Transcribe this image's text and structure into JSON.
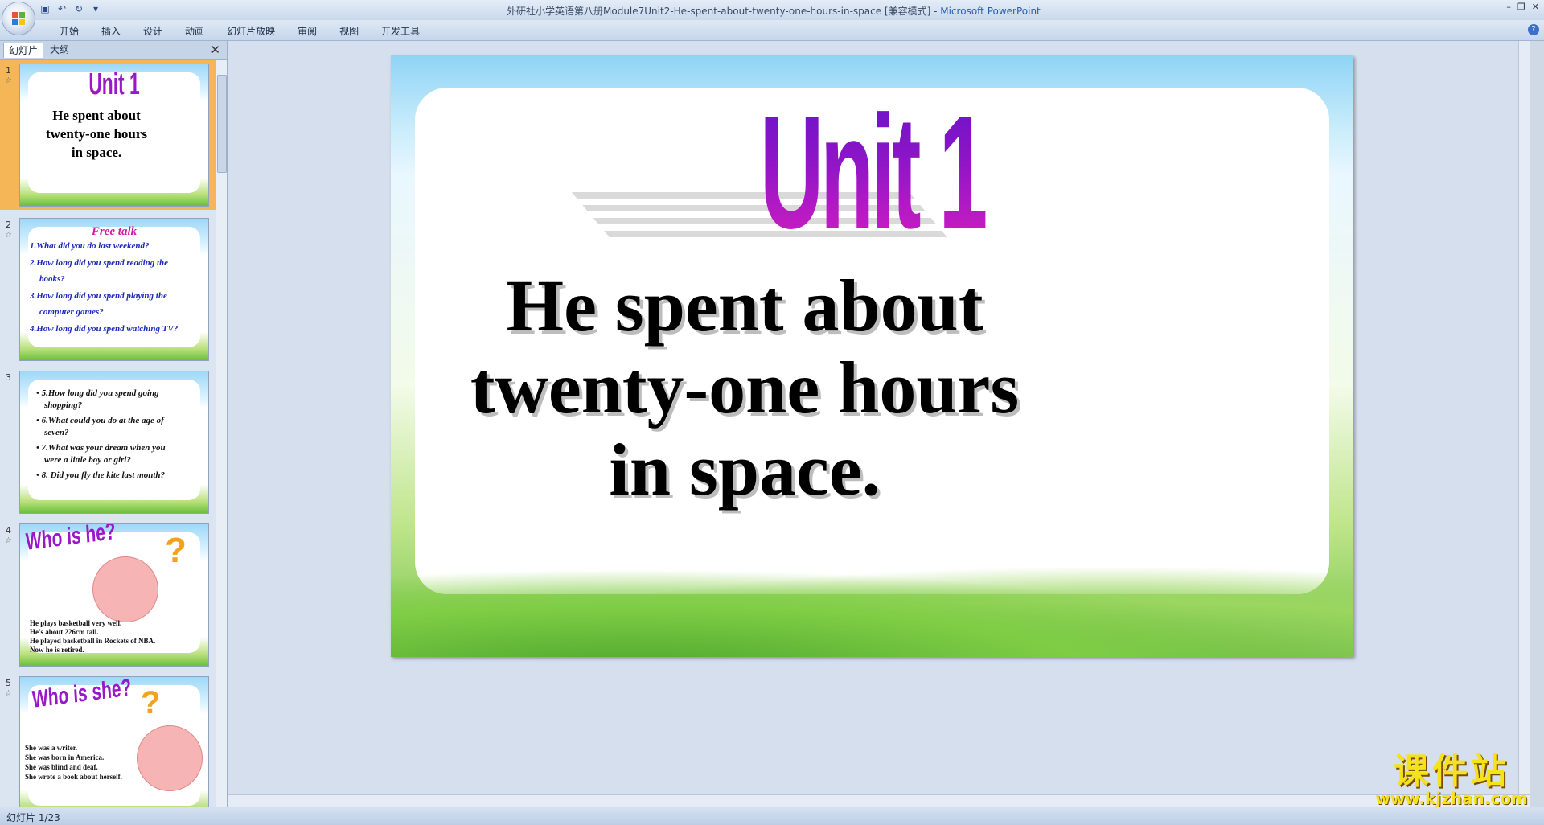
{
  "window": {
    "title_doc": "外研社小学英语第八册Module7Unit2-He-spent-about-twenty-one-hours-in-space [兼容模式] -",
    "title_app": "Microsoft PowerPoint"
  },
  "ribbon": {
    "tabs": [
      "开始",
      "插入",
      "设计",
      "动画",
      "幻灯片放映",
      "审阅",
      "视图",
      "开发工具"
    ]
  },
  "left_pane": {
    "tabs": [
      "幻灯片",
      "大纲"
    ],
    "slides": [
      {
        "num": "1",
        "title": "Unit 1",
        "lines": [
          "He spent about",
          "twenty-one hours",
          "in space."
        ]
      },
      {
        "num": "2",
        "title": "Free talk",
        "lines": [
          "1.What did you do last weekend?",
          "2.How long did you spend reading the",
          "books?",
          "3.How long did you spend playing the",
          "computer games?",
          "4.How long did you spend watching TV?"
        ]
      },
      {
        "num": "3",
        "lines": [
          "• 5.How long did you spend going",
          "shopping?",
          "• 6.What could you do at the age of",
          "seven?",
          "• 7.What was your dream when you",
          "were a little boy or girl?",
          "• 8.  Did you fly the kite last month?"
        ]
      },
      {
        "num": "4",
        "title": "Who is he?",
        "lines": [
          "He plays basketball very well.",
          "He's about 226cm tall.",
          "He played basketball in Rockets of NBA.",
          "Now he is retired."
        ]
      },
      {
        "num": "5",
        "title": "Who is she?",
        "lines": [
          "She was a writer.",
          "She was born in America.",
          "She was blind and deaf.",
          "She wrote a book about herself."
        ]
      }
    ]
  },
  "slide": {
    "title": "Unit 1",
    "line1": "He spent about",
    "line2": "twenty-one hours",
    "line3": "in space."
  },
  "watermark": {
    "main": "课件站",
    "url": "www.kjzhan.com"
  },
  "status": {
    "slide_count": "幻灯片 1/23"
  }
}
